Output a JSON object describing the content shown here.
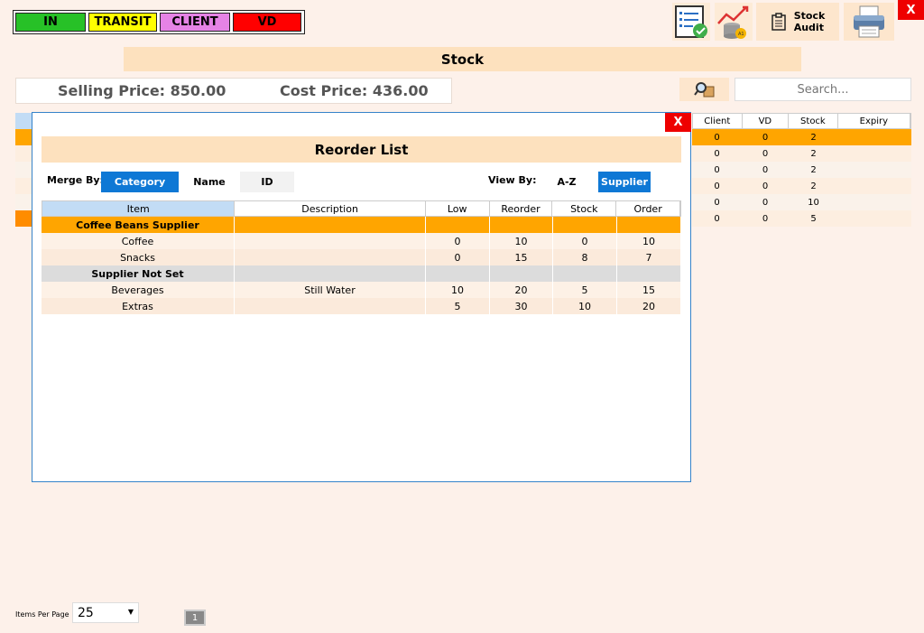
{
  "filters": {
    "in": "IN",
    "transit": "TRANSIT",
    "client": "CLIENT",
    "vd": "VD"
  },
  "toolbar": {
    "stock_audit_line1": "Stock",
    "stock_audit_line2": "Audit",
    "close": "X"
  },
  "stock_title": "Stock",
  "prices": {
    "selling": "Selling Price: 850.00",
    "cost": "Cost Price: 436.00"
  },
  "search": {
    "placeholder": "Search..."
  },
  "bg_table": {
    "headers": [
      "Client",
      "VD",
      "Stock",
      "Expiry"
    ],
    "rows": [
      [
        "0",
        "0",
        "2",
        ""
      ],
      [
        "0",
        "0",
        "2",
        ""
      ],
      [
        "0",
        "0",
        "2",
        ""
      ],
      [
        "0",
        "0",
        "2",
        ""
      ],
      [
        "0",
        "0",
        "10",
        ""
      ],
      [
        "0",
        "0",
        "5",
        ""
      ]
    ]
  },
  "modal": {
    "close": "X",
    "title": "Reorder List",
    "merge_by_label": "Merge By:",
    "merge_options": [
      "Category",
      "Name",
      "ID"
    ],
    "view_by_label": "View By:",
    "view_options": [
      "A-Z",
      "Supplier"
    ],
    "headers": [
      "Item",
      "Description",
      "Low",
      "Reorder",
      "Stock",
      "Order"
    ],
    "groups": [
      {
        "name": "Coffee Beans Supplier",
        "rows": [
          [
            "Coffee",
            "",
            "0",
            "10",
            "0",
            "10"
          ],
          [
            "Snacks",
            "",
            "0",
            "15",
            "8",
            "7"
          ]
        ]
      },
      {
        "name": "Supplier Not Set",
        "rows": [
          [
            "Beverages",
            "Still Water",
            "10",
            "20",
            "5",
            "15"
          ],
          [
            "Extras",
            "",
            "5",
            "30",
            "10",
            "20"
          ]
        ]
      }
    ]
  },
  "pagination": {
    "items_label": "Items Per Page",
    "items_value": "25",
    "page": "1"
  }
}
